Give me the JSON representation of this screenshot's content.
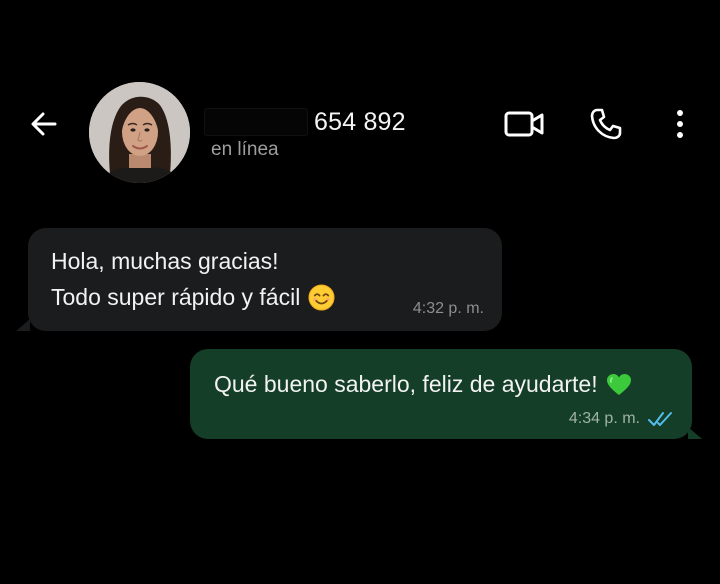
{
  "header": {
    "contact_name": "654 892",
    "presence": "en línea",
    "back_icon": "arrow-left-icon",
    "video_icon": "video-camera-icon",
    "call_icon": "phone-icon",
    "more_icon": "more-vertical-icon"
  },
  "messages": [
    {
      "direction": "incoming",
      "line1": "Hola, muchas gracias!",
      "line2": "Todo super rápido y fácil",
      "emoji": "smiling-face-icon",
      "time": "4:32 p. m."
    },
    {
      "direction": "outgoing",
      "text": "Qué bueno saberlo, feliz de ayudarte!",
      "emoji": "green-heart-icon",
      "time": "4:34 p. m.",
      "status": "read",
      "status_icon": "double-check-icon"
    }
  ],
  "colors": {
    "background": "#000000",
    "incoming_bubble": "#1b1c1e",
    "outgoing_bubble": "#143e27",
    "read_ticks": "#53bdeb",
    "secondary_text": "#9e9e9e"
  }
}
